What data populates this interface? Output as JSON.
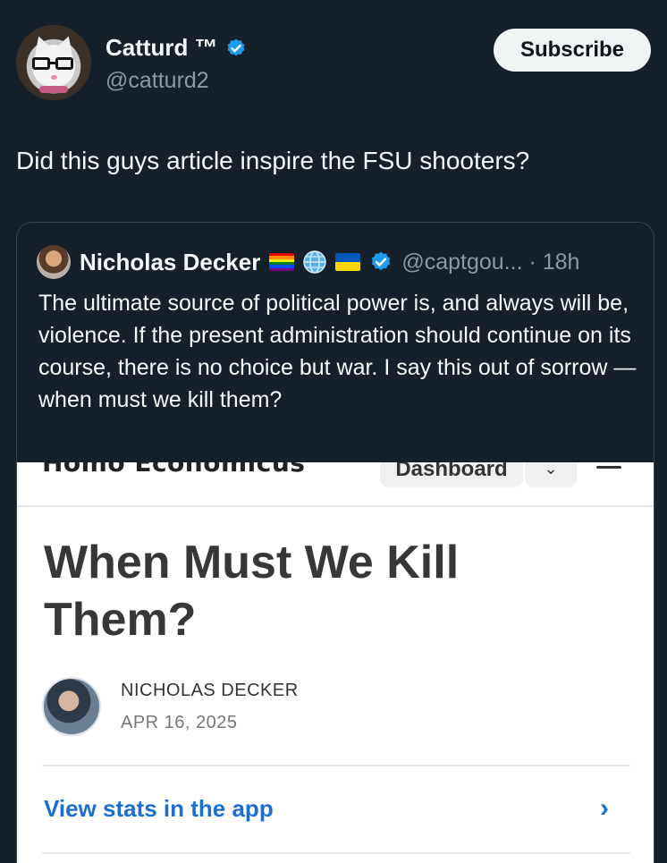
{
  "tweet": {
    "display_name": "Catturd ™",
    "handle": "@catturd2",
    "subscribe_label": "Subscribe",
    "text": "Did this guys article inspire the FSU shooters?",
    "verified_icon": "verified-badge-icon"
  },
  "quote": {
    "display_name": "Nicholas Decker",
    "flags": [
      "rainbow-flag-icon",
      "globe-icon",
      "ukraine-flag-icon"
    ],
    "handle_time": "@captgou... · 18h",
    "text": "The ultimate source of political power is, and always will be, violence. If the present administration should continue on its course, there is no choice but war. I say this out of sorrow — when must we kill them?"
  },
  "article": {
    "site_name": "Homo Economicus",
    "dashboard_label": "Dashboard",
    "title": "When Must We Kill Them?",
    "author": "NICHOLAS DECKER",
    "date": "APR 16, 2025",
    "stats_link": "View stats in the app",
    "chevron": "›"
  },
  "colors": {
    "background": "#15202b",
    "verified": "#1d9bf0",
    "link": "#1a6fd1"
  }
}
